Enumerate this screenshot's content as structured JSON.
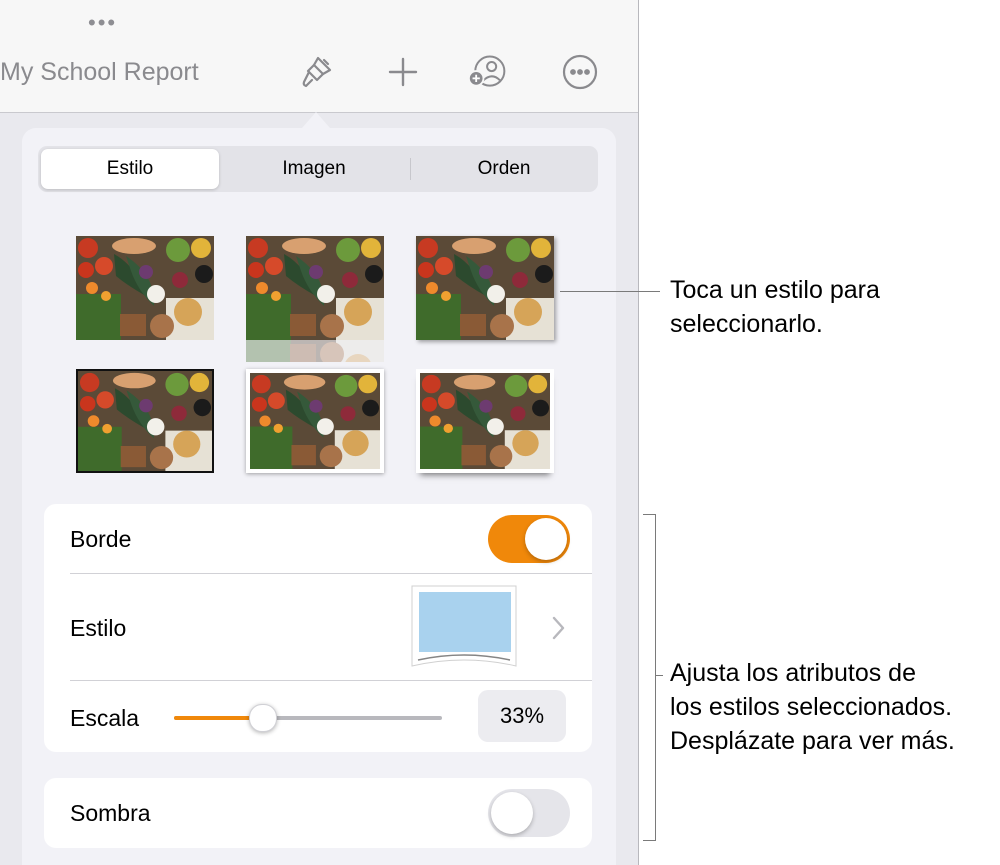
{
  "toolbar": {
    "more_dots": "•••",
    "document_title": "My School Report",
    "icons": [
      "paintbrush-icon",
      "plus-icon",
      "add-collaborator-icon",
      "more-icon"
    ]
  },
  "tabs": [
    {
      "label": "Estilo",
      "active": true
    },
    {
      "label": "Imagen",
      "active": false
    },
    {
      "label": "Orden",
      "active": false
    }
  ],
  "style_presets_count": 6,
  "border": {
    "label": "Borde",
    "on": true
  },
  "style_row": {
    "label": "Estilo"
  },
  "scale": {
    "label": "Escala",
    "value_text": "33%",
    "value": 0.33
  },
  "shadow": {
    "label": "Sombra",
    "on": false
  },
  "callouts": {
    "styles_line1": "Toca un estilo para",
    "styles_line2": "seleccionarlo.",
    "attrs_line1": "Ajusta los atributos de",
    "attrs_line2": "los estilos seleccionados.",
    "attrs_line3": "Desplázate para ver más."
  },
  "colors": {
    "accent": "#f0880a",
    "toggle_off": "#e5e5ea",
    "swatch": "#a9d2ee",
    "icon": "#8a8a8e"
  }
}
